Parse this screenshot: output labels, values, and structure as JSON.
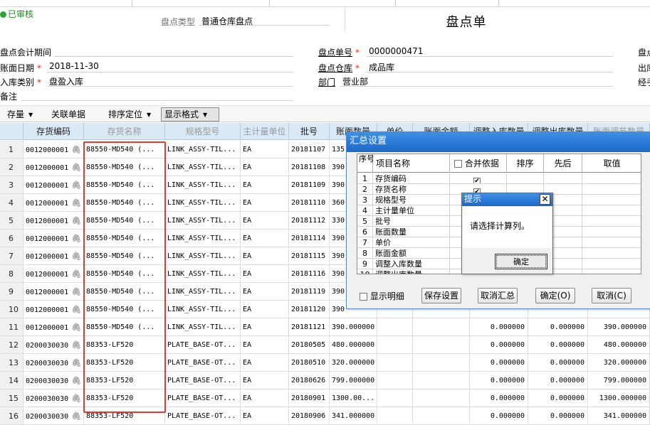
{
  "header": {
    "status": "已审核",
    "inventory_type_label": "盘点类型",
    "inventory_type_value": "普通仓库盘点",
    "doc_title": "盘点单"
  },
  "form": {
    "period_label": "盘点会计期间",
    "period_value": "",
    "book_date_label": "账面日期",
    "book_date_value": "2018-11-30",
    "in_type_label": "入库类别",
    "in_type_value": "盘盈入库",
    "remark_label": "备注",
    "doc_no_label": "盘点单号",
    "doc_no_value": "0000000471",
    "warehouse_label": "盘点仓库",
    "warehouse_value": "成品库",
    "dept_label": "部门",
    "dept_value": "营业部",
    "right_col_1": "盘点",
    "right_col_2": "出库",
    "right_col_3": "经手"
  },
  "toolbar": {
    "stock_label": "存量",
    "related_label": "关联单据",
    "sort_label": "排序定位",
    "display_label": "显示格式"
  },
  "grid": {
    "headers": [
      "存货编码",
      "存货名称",
      "规格型号",
      "主计量单位",
      "批号",
      "账面数量",
      "单价",
      "账面金额",
      "调整入库数量",
      "调整出库数量",
      "账面调节数量"
    ],
    "rows": [
      {
        "n": "1",
        "code": "0012000001",
        "name": "88550-MD540 (...",
        "spec": "LINK_ASSY-TIL...",
        "unit": "EA",
        "batch": "20181107",
        "qty": "135",
        "adj_in": "",
        "adj_out": "",
        "book_adj": ""
      },
      {
        "n": "2",
        "code": "0012000001",
        "name": "88550-MD540 (...",
        "spec": "LINK_ASSY-TIL...",
        "unit": "EA",
        "batch": "20181108",
        "qty": "390",
        "adj_in": "",
        "adj_out": "",
        "book_adj": ""
      },
      {
        "n": "3",
        "code": "0012000001",
        "name": "88550-MD540 (...",
        "spec": "LINK_ASSY-TIL...",
        "unit": "EA",
        "batch": "20181109",
        "qty": "390",
        "adj_in": "",
        "adj_out": "",
        "book_adj": ""
      },
      {
        "n": "4",
        "code": "0012000001",
        "name": "88550-MD540 (...",
        "spec": "LINK_ASSY-TIL...",
        "unit": "EA",
        "batch": "20181110",
        "qty": "360",
        "adj_in": "",
        "adj_out": "",
        "book_adj": ""
      },
      {
        "n": "5",
        "code": "0012000001",
        "name": "88550-MD540 (...",
        "spec": "LINK_ASSY-TIL...",
        "unit": "EA",
        "batch": "20181112",
        "qty": "330",
        "adj_in": "",
        "adj_out": "",
        "book_adj": ""
      },
      {
        "n": "6",
        "code": "0012000001",
        "name": "88550-MD540 (...",
        "spec": "LINK_ASSY-TIL...",
        "unit": "EA",
        "batch": "20181114",
        "qty": "390",
        "adj_in": "",
        "adj_out": "",
        "book_adj": ""
      },
      {
        "n": "7",
        "code": "0012000001",
        "name": "88550-MD540 (...",
        "spec": "LINK_ASSY-TIL...",
        "unit": "EA",
        "batch": "20181115",
        "qty": "390",
        "adj_in": "",
        "adj_out": "",
        "book_adj": ""
      },
      {
        "n": "8",
        "code": "0012000001",
        "name": "88550-MD540 (...",
        "spec": "LINK_ASSY-TIL...",
        "unit": "EA",
        "batch": "20181116",
        "qty": "390",
        "adj_in": "",
        "adj_out": "",
        "book_adj": ""
      },
      {
        "n": "9",
        "code": "0012000001",
        "name": "88550-MD540 (...",
        "spec": "LINK_ASSY-TIL...",
        "unit": "EA",
        "batch": "20181119",
        "qty": "390",
        "adj_in": "",
        "adj_out": "",
        "book_adj": ""
      },
      {
        "n": "10",
        "code": "0012000001",
        "name": "88550-MD540 (...",
        "spec": "LINK_ASSY-TIL...",
        "unit": "EA",
        "batch": "20181120",
        "qty": "390",
        "adj_in": "",
        "adj_out": "",
        "book_adj": ""
      },
      {
        "n": "11",
        "code": "0012000001",
        "name": "88550-MD540 (...",
        "spec": "LINK_ASSY-TIL...",
        "unit": "EA",
        "batch": "20181121",
        "qty": "390.000000",
        "adj_in": "0.000000",
        "adj_out": "0.000000",
        "book_adj": "390.000000"
      },
      {
        "n": "12",
        "code": "0200030030",
        "name": "88353-LF520",
        "spec": "PLATE_BASE-OT...",
        "unit": "EA",
        "batch": "20180505",
        "qty": "480.000000",
        "adj_in": "0.000000",
        "adj_out": "0.000000",
        "book_adj": "480.000000"
      },
      {
        "n": "13",
        "code": "0200030030",
        "name": "88353-LF520",
        "spec": "PLATE_BASE-OT...",
        "unit": "EA",
        "batch": "20180510",
        "qty": "320.000000",
        "adj_in": "0.000000",
        "adj_out": "0.000000",
        "book_adj": "320.000000"
      },
      {
        "n": "14",
        "code": "0200030030",
        "name": "88353-LF520",
        "spec": "PLATE_BASE-OT...",
        "unit": "EA",
        "batch": "20180626",
        "qty": "799.000000",
        "adj_in": "0.000000",
        "adj_out": "0.000000",
        "book_adj": "799.000000"
      },
      {
        "n": "15",
        "code": "0200030030",
        "name": "88353-LF520",
        "spec": "PLATE_BASE-OT...",
        "unit": "EA",
        "batch": "20180901",
        "qty": "1300.00...",
        "adj_in": "0.000000",
        "adj_out": "0.000000",
        "book_adj": "1300.000000"
      },
      {
        "n": "16",
        "code": "0200030030",
        "name": "88353-LF520",
        "spec": "PLATE_BASE-OT...",
        "unit": "EA",
        "batch": "20180906",
        "qty": "341.000000",
        "adj_in": "0.000000",
        "adj_out": "0.000000",
        "book_adj": "341.000000"
      }
    ]
  },
  "summary_dialog": {
    "title": "汇总设置",
    "headers": {
      "seq": "序号",
      "item": "项目名称",
      "merge": "合并依据",
      "sort": "排序",
      "order": "先后",
      "value": "取值"
    },
    "rows": [
      {
        "n": "1",
        "item": "存货编码",
        "checked": true
      },
      {
        "n": "2",
        "item": "存货名称",
        "checked": true
      },
      {
        "n": "3",
        "item": "规格型号",
        "checked": true
      },
      {
        "n": "4",
        "item": "主计量单位",
        "checked": false
      },
      {
        "n": "5",
        "item": "批号",
        "checked": false
      },
      {
        "n": "6",
        "item": "账面数量",
        "checked": false
      },
      {
        "n": "7",
        "item": "单价",
        "checked": false
      },
      {
        "n": "8",
        "item": "账面金额",
        "checked": false
      },
      {
        "n": "9",
        "item": "调整入库数量",
        "checked": false
      },
      {
        "n": "10",
        "item": "调整出库数量",
        "checked": false
      }
    ],
    "show_detail_label": "显示明细",
    "save_label": "保存设置",
    "cancel_summary_label": "取消汇总",
    "ok_label": "确定(O)",
    "cancel_label": "取消(C)"
  },
  "alert": {
    "title": "提示",
    "message": "请选择计算列。",
    "ok_label": "确定"
  },
  "colors": {
    "status_green": "#2fa32f",
    "highlight_red": "#e23b2e",
    "title_blue": "#1b69c8",
    "grid_header": "#dbe8f5"
  }
}
